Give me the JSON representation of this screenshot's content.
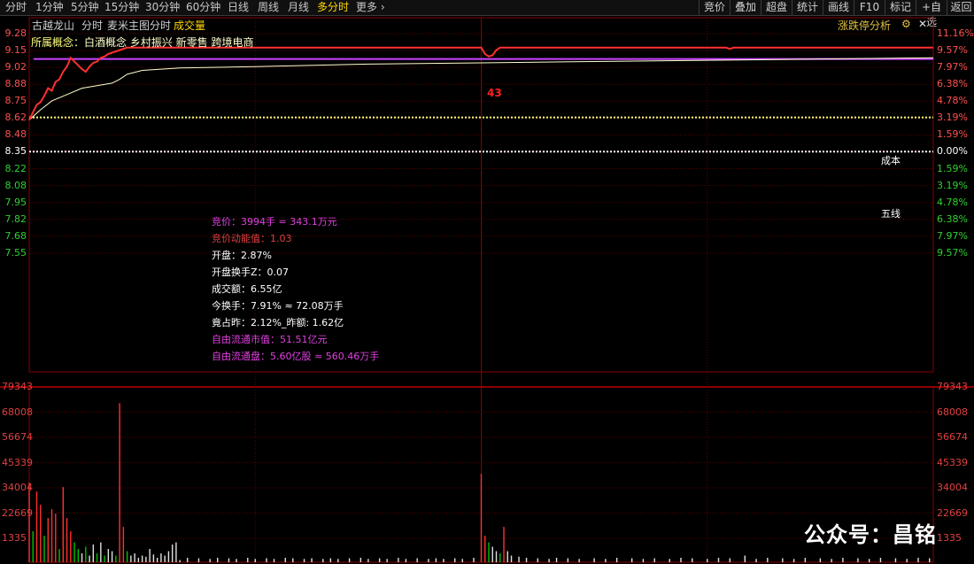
{
  "toolbar": {
    "tabs": [
      "分时",
      "1分钟",
      "5分钟",
      "15分钟",
      "30分钟",
      "60分钟",
      "日线",
      "周线",
      "月线",
      "多分时",
      "更多"
    ],
    "active_tab": "多分时",
    "right_buttons": [
      "竞价",
      "叠加",
      "超盘",
      "统计",
      "画线",
      "F10",
      "标记",
      "+自选",
      "返回"
    ]
  },
  "header": {
    "stock_name": "古越龙山",
    "chart_mode": "分时",
    "main_chart_label": "麦米主图分时",
    "volume_label": "成交量",
    "analysis_link": "涨跌停分析",
    "concepts_label": "所属概念：",
    "concepts": "白酒概念 乡村振兴 新零售 跨境电商"
  },
  "price_axis": [
    "9.28",
    "9.15",
    "9.02",
    "8.88",
    "8.75",
    "8.62",
    "8.48",
    "8.35",
    "8.22",
    "8.08",
    "7.95",
    "7.82",
    "7.68",
    "7.55"
  ],
  "pct_axis": [
    "11.16%",
    "9.57%",
    "7.97%",
    "6.38%",
    "4.78%",
    "3.19%",
    "1.59%",
    "0.00%",
    "1.59%",
    "3.19%",
    "4.78%",
    "6.38%",
    "7.97%",
    "9.57%"
  ],
  "volume_axis": [
    "79343",
    "68008",
    "56674",
    "45339",
    "34004",
    "22669",
    "1335"
  ],
  "markers": {
    "cost": "成本",
    "five_line": "五线",
    "event_count": "43"
  },
  "info": [
    {
      "label": "竞价：",
      "value": "3994手 = 343.1万元",
      "color": "#e040e0"
    },
    {
      "label": "竞价动能值：",
      "value": "1.03",
      "color": "#e04040"
    },
    {
      "label": "开盘：",
      "value": "2.87%",
      "color": "#ffffff"
    },
    {
      "label": "开盘换手Z：",
      "value": "0.07",
      "color": "#ffffff"
    },
    {
      "label": "成交额：",
      "value": "6.55亿",
      "color": "#ffffff"
    },
    {
      "label": "今换手：",
      "value": "7.91% ≈ 72.08万手",
      "color": "#ffffff"
    },
    {
      "label": "竟占昨：",
      "value": "2.12%_昨额: 1.62亿",
      "color": "#ffffff"
    },
    {
      "label": "自由流通市值：",
      "value": "51.51亿元",
      "color": "#e040e0"
    },
    {
      "label": "自由流通盘：",
      "value": "5.60亿股 ≈ 560.46万手",
      "color": "#e040e0"
    }
  ],
  "watermark": "公众号：昌铭",
  "colors": {
    "up": "#ff3030",
    "down": "#00c000",
    "avg": "#ffffcc",
    "cost_line": "#ffff80",
    "ma_line": "#cc44ff",
    "grid": "#5a0000"
  },
  "chart_data": {
    "type": "line",
    "title": "",
    "y_range_price": [
      7.55,
      9.28
    ],
    "y_base_close": 8.35,
    "price_series": [
      [
        0,
        8.6
      ],
      [
        1,
        8.66
      ],
      [
        2,
        8.72
      ],
      [
        3,
        8.74
      ],
      [
        4,
        8.79
      ],
      [
        5,
        8.85
      ],
      [
        6,
        8.83
      ],
      [
        7,
        8.9
      ],
      [
        8,
        8.92
      ],
      [
        9,
        8.98
      ],
      [
        10,
        9.02
      ],
      [
        11,
        9.09
      ],
      [
        12,
        9.06
      ],
      [
        13,
        9.03
      ],
      [
        14,
        9.0
      ],
      [
        15,
        8.98
      ],
      [
        16,
        9.02
      ],
      [
        17,
        9.05
      ],
      [
        18,
        9.06
      ],
      [
        19,
        9.09
      ],
      [
        20,
        9.1
      ],
      [
        21,
        9.12
      ],
      [
        22,
        9.13
      ],
      [
        24,
        9.15
      ],
      [
        26,
        9.17
      ],
      [
        120,
        9.17
      ],
      [
        121,
        9.12
      ],
      [
        122,
        9.1
      ],
      [
        123,
        9.11
      ],
      [
        124,
        9.15
      ],
      [
        125,
        9.17
      ],
      [
        185,
        9.17
      ],
      [
        186,
        9.16
      ],
      [
        187,
        9.17
      ],
      [
        240,
        9.17
      ]
    ],
    "avg_series": [
      [
        0,
        8.6
      ],
      [
        3,
        8.68
      ],
      [
        6,
        8.75
      ],
      [
        10,
        8.8
      ],
      [
        14,
        8.85
      ],
      [
        18,
        8.87
      ],
      [
        22,
        8.89
      ],
      [
        24,
        8.92
      ],
      [
        26,
        8.96
      ],
      [
        30,
        8.99
      ],
      [
        40,
        9.01
      ],
      [
        60,
        9.02
      ],
      [
        90,
        9.04
      ],
      [
        120,
        9.05
      ],
      [
        150,
        9.06
      ],
      [
        180,
        9.07
      ],
      [
        210,
        9.08
      ],
      [
        240,
        9.09
      ]
    ],
    "cost_price": 8.62,
    "five_line_price": 8.35,
    "ma_price": 9.08,
    "volume_range": [
      0,
      79343
    ],
    "volume_bars": [
      [
        0,
        36000,
        "up"
      ],
      [
        1,
        14000,
        "down"
      ],
      [
        2,
        32000,
        "up"
      ],
      [
        3,
        26000,
        "up"
      ],
      [
        4,
        12000,
        "down"
      ],
      [
        5,
        20000,
        "up"
      ],
      [
        6,
        24000,
        "up"
      ],
      [
        7,
        22000,
        "up"
      ],
      [
        8,
        6000,
        "down"
      ],
      [
        9,
        34000,
        "up"
      ],
      [
        10,
        20000,
        "up"
      ],
      [
        11,
        14000,
        "up"
      ],
      [
        12,
        9000,
        "down"
      ],
      [
        13,
        6000,
        "down"
      ],
      [
        14,
        4000,
        "up"
      ],
      [
        15,
        7000,
        "down"
      ],
      [
        16,
        3000,
        "up"
      ],
      [
        17,
        8000,
        "up"
      ],
      [
        18,
        4000,
        "down"
      ],
      [
        19,
        9000,
        "up"
      ],
      [
        20,
        3000,
        "down"
      ],
      [
        21,
        6000,
        "up"
      ],
      [
        22,
        5000,
        "up"
      ],
      [
        23,
        3000,
        "down"
      ],
      [
        24,
        72000,
        "up"
      ],
      [
        25,
        16000,
        "up"
      ],
      [
        26,
        5000,
        "down"
      ],
      [
        27,
        3000,
        "up"
      ],
      [
        28,
        4000,
        "up"
      ],
      [
        29,
        2000,
        "up"
      ],
      [
        30,
        3000,
        "up"
      ],
      [
        31,
        2500,
        "up"
      ],
      [
        32,
        6000,
        "up"
      ],
      [
        33,
        3500,
        "up"
      ],
      [
        34,
        2000,
        "up"
      ],
      [
        35,
        4000,
        "up"
      ],
      [
        36,
        3000,
        "up"
      ],
      [
        37,
        5000,
        "up"
      ],
      [
        38,
        8000,
        "up"
      ],
      [
        39,
        9000,
        "up"
      ],
      [
        40,
        1000,
        "up"
      ],
      [
        42,
        2000,
        "up"
      ],
      [
        45,
        1800,
        "up"
      ],
      [
        48,
        1500,
        "up"
      ],
      [
        50,
        2000,
        "up"
      ],
      [
        53,
        1800,
        "up"
      ],
      [
        55,
        1500,
        "up"
      ],
      [
        58,
        2000,
        "up"
      ],
      [
        60,
        1500,
        "up"
      ],
      [
        63,
        1800,
        "up"
      ],
      [
        65,
        1500,
        "up"
      ],
      [
        68,
        2000,
        "up"
      ],
      [
        70,
        1800,
        "up"
      ],
      [
        73,
        1500,
        "up"
      ],
      [
        75,
        1800,
        "up"
      ],
      [
        78,
        1500,
        "up"
      ],
      [
        80,
        1800,
        "up"
      ],
      [
        82,
        1500,
        "up"
      ],
      [
        85,
        1800,
        "up"
      ],
      [
        88,
        2000,
        "up"
      ],
      [
        90,
        1500,
        "up"
      ],
      [
        93,
        1800,
        "up"
      ],
      [
        95,
        1500,
        "up"
      ],
      [
        98,
        2000,
        "up"
      ],
      [
        100,
        1500,
        "up"
      ],
      [
        103,
        1800,
        "up"
      ],
      [
        106,
        1500,
        "up"
      ],
      [
        108,
        1800,
        "up"
      ],
      [
        110,
        1500,
        "up"
      ],
      [
        113,
        1800,
        "up"
      ],
      [
        115,
        1500,
        "up"
      ],
      [
        118,
        2000,
        "up"
      ],
      [
        120,
        40000,
        "up"
      ],
      [
        121,
        12000,
        "up"
      ],
      [
        122,
        9000,
        "down"
      ],
      [
        123,
        7000,
        "up"
      ],
      [
        124,
        5000,
        "up"
      ],
      [
        125,
        4000,
        "down"
      ],
      [
        126,
        16000,
        "up"
      ],
      [
        127,
        5000,
        "up"
      ],
      [
        128,
        3000,
        "up"
      ],
      [
        130,
        2500,
        "up"
      ],
      [
        132,
        2000,
        "up"
      ],
      [
        135,
        1800,
        "up"
      ],
      [
        138,
        1500,
        "up"
      ],
      [
        140,
        2000,
        "up"
      ],
      [
        143,
        1800,
        "up"
      ],
      [
        146,
        1500,
        "up"
      ],
      [
        150,
        1800,
        "up"
      ],
      [
        153,
        1500,
        "up"
      ],
      [
        156,
        2000,
        "up"
      ],
      [
        160,
        1800,
        "up"
      ],
      [
        163,
        1500,
        "up"
      ],
      [
        166,
        1800,
        "up"
      ],
      [
        170,
        1500,
        "up"
      ],
      [
        173,
        2000,
        "up"
      ],
      [
        176,
        1800,
        "up"
      ],
      [
        180,
        1500,
        "up"
      ],
      [
        183,
        2000,
        "up"
      ],
      [
        186,
        1800,
        "up"
      ],
      [
        190,
        3000,
        "up"
      ],
      [
        193,
        1500,
        "up"
      ],
      [
        196,
        2000,
        "up"
      ],
      [
        200,
        1800,
        "up"
      ],
      [
        203,
        1500,
        "up"
      ],
      [
        206,
        2000,
        "up"
      ],
      [
        210,
        1800,
        "up"
      ],
      [
        213,
        1500,
        "up"
      ],
      [
        216,
        2000,
        "up"
      ],
      [
        220,
        1800,
        "up"
      ],
      [
        223,
        1500,
        "up"
      ],
      [
        226,
        2000,
        "up"
      ],
      [
        230,
        1800,
        "up"
      ],
      [
        233,
        1500,
        "up"
      ],
      [
        236,
        2000,
        "up"
      ],
      [
        239,
        1800,
        "up"
      ]
    ]
  }
}
